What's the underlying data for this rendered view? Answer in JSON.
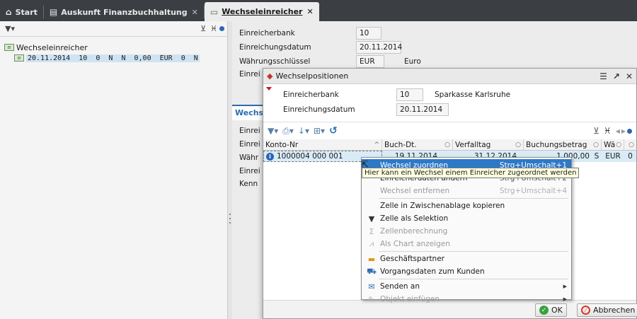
{
  "tabs": [
    {
      "label": "Start",
      "icon": "home-icon"
    },
    {
      "label": "Auskunft Finanzbuchhaltung",
      "icon": "window-icon",
      "close": "✕"
    },
    {
      "label": "Wechseleinreicher",
      "icon": "bill-icon",
      "close": "✕",
      "active": true
    }
  ],
  "tree": {
    "root": "Wechseleinreicher",
    "child": "20.11.2014  10  0  N  N  0,00  EUR  0  N"
  },
  "form": {
    "rows": [
      {
        "label": "Einreicherbank",
        "value": "10"
      },
      {
        "label": "Einreichungsdatum",
        "value": "20.11.2014"
      },
      {
        "label": "Währungsschlüssel",
        "value": "EUR",
        "text": "Euro"
      },
      {
        "label": "Einrei"
      }
    ],
    "section_title": "Wechse",
    "section_rows": [
      "Einrei",
      "Einrei",
      "Währ",
      "Einrei",
      "Kenn"
    ]
  },
  "dialog": {
    "title": "Wechselpositionen",
    "fields": [
      {
        "label": "Einreicherbank",
        "value": "10",
        "text": "Sparkasse Karlsruhe"
      },
      {
        "label": "Einreichungsdatum",
        "value": "20.11.2014"
      }
    ],
    "columns": [
      "Konto-Nr",
      "Buch-Dt.",
      "Verfalltag",
      "Buchungsbetrag",
      "Wä",
      ""
    ],
    "row": {
      "konto": "1000004 000 001",
      "buch_dt": "19.11.2014",
      "verfalltag": "31.12.2014",
      "betrag": "1.000,00",
      "sh": "S",
      "waehrung": "EUR",
      "last": "0"
    },
    "ok_label": "OK",
    "cancel_label": "Abbrechen"
  },
  "tooltip": "Hier kann ein Wechsel einem Einreicher zugeordnet werden",
  "menu": {
    "items": [
      {
        "label": "Wechsel zuordnen",
        "shortcut": "Strg+Umschalt+1",
        "icon": "",
        "state": "highlight"
      },
      {
        "label": "Einreicherdaten ändern",
        "shortcut": "Strg+Umschalt+2",
        "icon": "",
        "state": "normal"
      },
      {
        "label": "Wechsel entfernen",
        "shortcut": "Strg+Umschalt+4",
        "icon": "",
        "state": "disabled"
      },
      {
        "label": "Zelle in Zwischenablage kopieren",
        "shortcut": "",
        "icon": "",
        "state": "normal"
      },
      {
        "label": "Zelle als Selektion",
        "shortcut": "",
        "icon": "filter-icon",
        "state": "normal"
      },
      {
        "label": "Zellenberechnung",
        "shortcut": "",
        "icon": "sum-icon",
        "state": "disabled"
      },
      {
        "label": "Als Chart anzeigen",
        "shortcut": "",
        "icon": "chart-icon",
        "state": "disabled"
      },
      {
        "label": "Geschäftspartner",
        "shortcut": "",
        "icon": "partner-icon",
        "state": "normal"
      },
      {
        "label": "Vorgangsdaten zum Kunden",
        "shortcut": "",
        "icon": "cart-icon",
        "state": "normal"
      },
      {
        "label": "Senden an",
        "shortcut": "",
        "icon": "send-icon",
        "state": "submenu"
      },
      {
        "label": "Objekt einfügen",
        "shortcut": "",
        "icon": "pencil-icon",
        "state": "submenu-disabled"
      }
    ]
  },
  "colors": {
    "accent": "#2c79c8",
    "tabbar": "#3b3f44",
    "row_selected": "#d9ebf7"
  }
}
